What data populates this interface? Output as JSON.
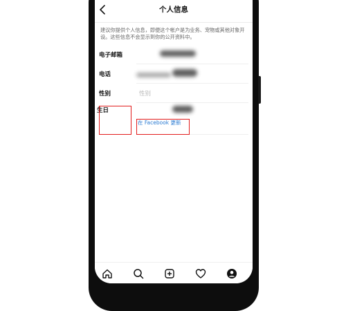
{
  "header": {
    "title": "个人信息"
  },
  "description": "建议你提供个人信息，即便这个帐户是为业务、宠物或其他对象开设。这些信息不会显示到你的公开资料中。",
  "fields": {
    "email": {
      "label": "电子邮箱"
    },
    "phone": {
      "label": "电话"
    },
    "gender": {
      "label": "性别",
      "placeholder": "性别"
    },
    "birthday": {
      "label": "生日",
      "update_link": "在 Facebook 更新"
    }
  },
  "tabbar": {
    "icons": [
      "home-icon",
      "search-icon",
      "new-post-icon",
      "activity-heart-icon",
      "profile-icon"
    ]
  },
  "colors": {
    "highlight": "#e21b1b",
    "link": "#2b7cd3"
  }
}
